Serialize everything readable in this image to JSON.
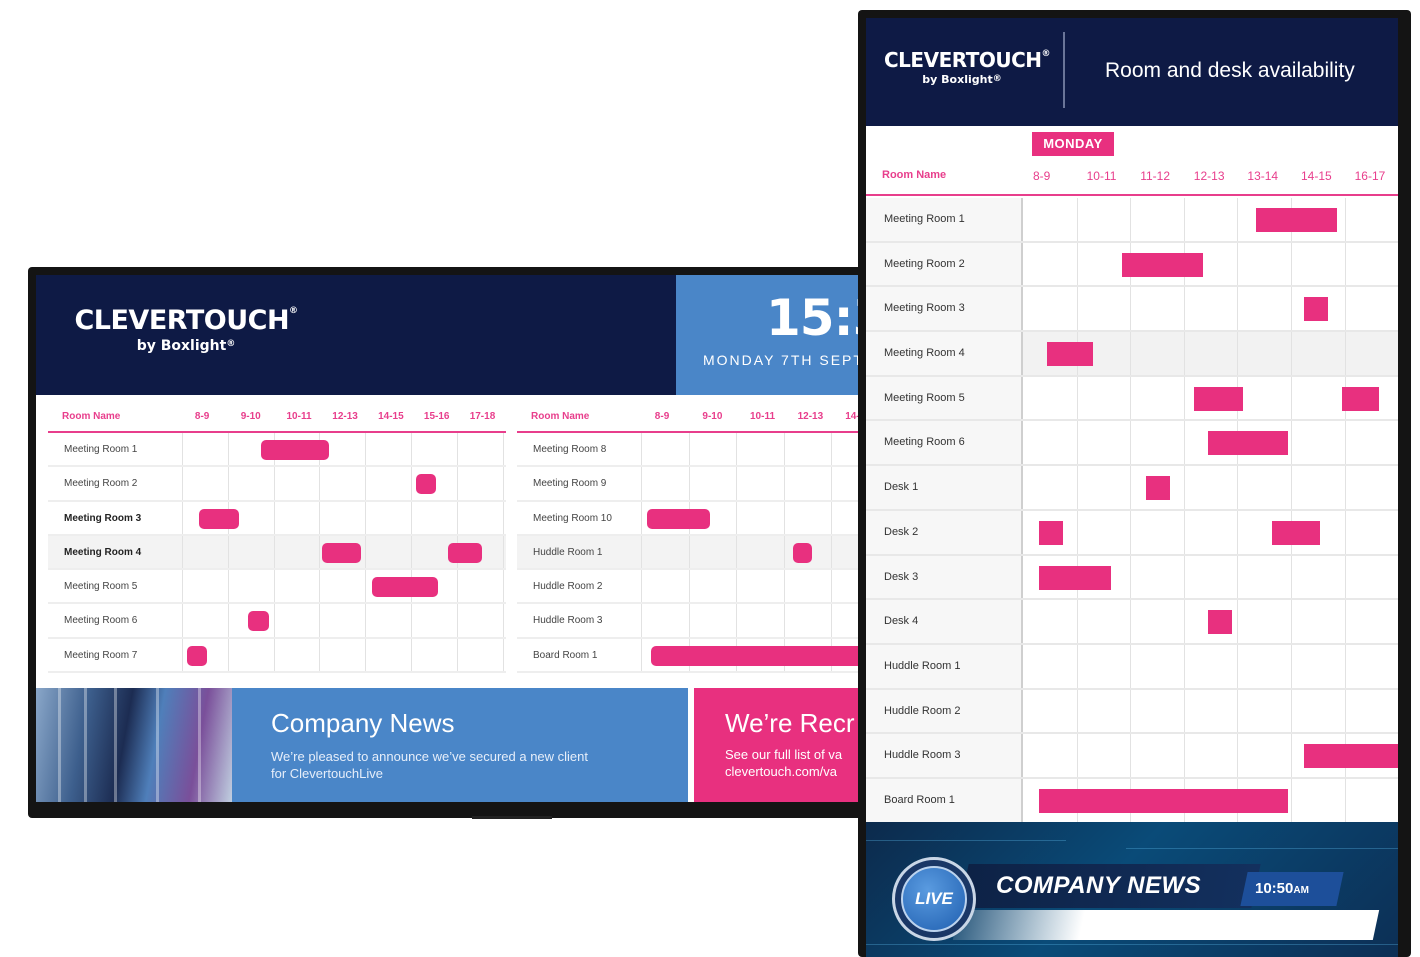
{
  "landscape": {
    "brand": {
      "name": "CLEVERTOUCH",
      "reg": "®",
      "by": "by Boxlight",
      "by_reg": "®"
    },
    "clock": {
      "time": "15:3",
      "date": "MONDAY 7TH SEPTE"
    },
    "tables": [
      {
        "header": {
          "room_name": "Room Name",
          "slots": [
            "8-9",
            "9-10",
            "10-11",
            "12-13",
            "14-15",
            "15-16",
            "17-18"
          ]
        },
        "rows": [
          {
            "name": "Meeting Room 1",
            "bookings": [
              [
                1.72,
                3.2
              ]
            ]
          },
          {
            "name": "Meeting Room 2",
            "bookings": [
              [
                5.1,
                5.55
              ]
            ]
          },
          {
            "name": "Meeting Room 3",
            "bookings": [
              [
                0.38,
                1.25
              ]
            ]
          },
          {
            "name": "Meeting Room 4",
            "bookings": [
              [
                3.05,
                3.9
              ],
              [
                5.8,
                6.55
              ]
            ]
          },
          {
            "name": "Meeting Room 5",
            "bookings": [
              [
                4.15,
                5.6
              ]
            ]
          },
          {
            "name": "Meeting Room 6",
            "bookings": [
              [
                1.45,
                1.9
              ]
            ]
          },
          {
            "name": "Meeting Room 7",
            "bookings": [
              [
                0.1,
                0.55
              ]
            ]
          }
        ]
      },
      {
        "header": {
          "room_name": "Room Name",
          "slots": [
            "8-9",
            "9-10",
            "10-11",
            "12-13",
            "14-1"
          ]
        },
        "rows": [
          {
            "name": "Meeting Room 8",
            "bookings": []
          },
          {
            "name": "Meeting Room 9",
            "bookings": []
          },
          {
            "name": "Meeting Room 10",
            "bookings": [
              [
                0.13,
                1.45
              ]
            ]
          },
          {
            "name": "Huddle Room 1",
            "bookings": [
              [
                3.2,
                3.6
              ]
            ]
          },
          {
            "name": "Huddle Room 2",
            "bookings": []
          },
          {
            "name": "Huddle Room 3",
            "bookings": []
          },
          {
            "name": "Board Room 1",
            "bookings": [
              [
                0.2,
                5.0
              ]
            ]
          }
        ]
      }
    ],
    "news": {
      "title": "Company News",
      "subtitle": "We’re pleased to announce we’ve secured a new client for ClevertouchLive"
    },
    "recruit": {
      "title": "We’re Recr",
      "line1": "See our full list of va",
      "line2": "clevertouch.com/va"
    }
  },
  "portrait": {
    "brand": {
      "name": "CLEVERTOUCH",
      "reg": "®",
      "by": "by Boxlight",
      "by_reg": "®"
    },
    "title": "Room and desk availability",
    "day": "MONDAY",
    "room_name_label": "Room Name",
    "slots": [
      "8-9",
      "10-11",
      "11-12",
      "12-13",
      "13-14",
      "14-15",
      "16-17"
    ],
    "rows": [
      {
        "name": "Meeting Room 1",
        "bookings": [
          [
            4.2,
            5.7
          ]
        ]
      },
      {
        "name": "Meeting Room 2",
        "bookings": [
          [
            1.7,
            3.2
          ]
        ]
      },
      {
        "name": "Meeting Room 3",
        "bookings": [
          [
            5.1,
            5.55
          ]
        ]
      },
      {
        "name": "Meeting Room 4",
        "bookings": [
          [
            0.3,
            1.15
          ]
        ]
      },
      {
        "name": "Meeting Room 5",
        "bookings": [
          [
            3.05,
            3.95
          ],
          [
            5.8,
            6.5
          ]
        ]
      },
      {
        "name": "Meeting Room 6",
        "bookings": [
          [
            3.3,
            4.8
          ]
        ]
      },
      {
        "name": "Desk 1",
        "bookings": [
          [
            2.15,
            2.6
          ]
        ]
      },
      {
        "name": "Desk 2",
        "bookings": [
          [
            0.15,
            0.6
          ],
          [
            4.5,
            5.4
          ]
        ]
      },
      {
        "name": "Desk 3",
        "bookings": [
          [
            0.15,
            1.5
          ]
        ]
      },
      {
        "name": "Desk 4",
        "bookings": [
          [
            3.3,
            3.75
          ]
        ]
      },
      {
        "name": "Huddle Room 1",
        "bookings": []
      },
      {
        "name": "Huddle Room 2",
        "bookings": []
      },
      {
        "name": "Huddle Room 3",
        "bookings": [
          [
            5.1,
            6.9
          ]
        ]
      },
      {
        "name": "Board Room 1",
        "bookings": [
          [
            0.15,
            4.8
          ]
        ]
      }
    ],
    "footer": {
      "live": "LIVE",
      "title": "COMPANY NEWS",
      "time": "10:50",
      "ampm": "AM"
    }
  },
  "colors": {
    "navy": "#0e1a45",
    "blue": "#4a86c8",
    "pink": "#e8307f"
  }
}
